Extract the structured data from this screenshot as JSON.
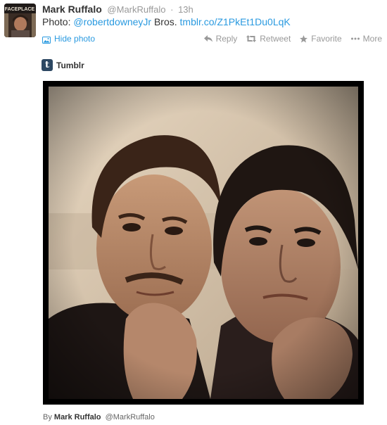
{
  "tweet": {
    "author_name": "Mark Ruffalo",
    "author_handle": "@MarkRuffalo",
    "separator": "·",
    "timestamp": "13h",
    "text_prefix": "Photo:",
    "mention": "@robertdowneyJr",
    "text_middle": "Bros.",
    "link_text": "tmblr.co/Z1PkEt1Du0LqK",
    "avatar_caption": "FACEPLACE"
  },
  "media": {
    "hide_label": "Hide photo",
    "provider_name": "Tumblr",
    "provider_icon_letter": "t",
    "image_alt": "Selfie of two men resting chin on hand"
  },
  "actions": {
    "reply": "Reply",
    "retweet": "Retweet",
    "favorite": "Favorite",
    "more": "More"
  },
  "byline": {
    "prefix": "By",
    "name": "Mark Ruffalo",
    "handle": "@MarkRuffalo"
  },
  "colors": {
    "link": "#2a9ae0",
    "muted": "#999999",
    "tumblr_badge": "#2c4762",
    "photo_border": "#000000"
  },
  "icons": {
    "reply": "reply-arrow-icon",
    "retweet": "retweet-icon",
    "favorite": "star-icon",
    "more": "ellipsis-icon",
    "hide_photo": "photo-icon",
    "provider": "tumblr-logo-icon"
  }
}
